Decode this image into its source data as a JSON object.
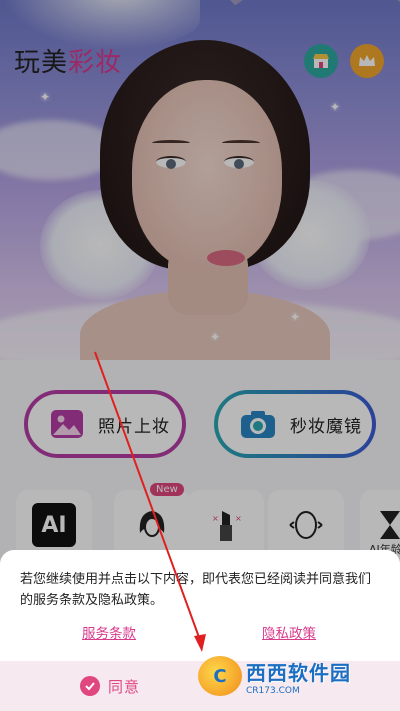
{
  "header": {
    "title_part1": "玩美",
    "title_part2": "彩妆",
    "icons": [
      "shop-icon",
      "crown-icon"
    ]
  },
  "actions": {
    "photo_makeup": "照片上妆",
    "instant_mirror": "秒妆魔镜"
  },
  "tools": {
    "ai_label": "AI",
    "new_badge": "New",
    "partial_label": "AI年龄"
  },
  "consent": {
    "text": "若您继续使用并点击以下内容，即代表您已经阅读并同意我们的服务条款及隐私政策。",
    "terms_link": "服务条款",
    "privacy_link": "隐私政策",
    "agree_button": "同意"
  },
  "watermark": {
    "main": "西西软件园",
    "sub": "CR173.COM"
  },
  "colors": {
    "brand_pink": "#d83a8c",
    "accent_purple": "#b53ea6",
    "accent_teal": "#2aa8b3",
    "agree_bg": "#f6e9f0"
  }
}
